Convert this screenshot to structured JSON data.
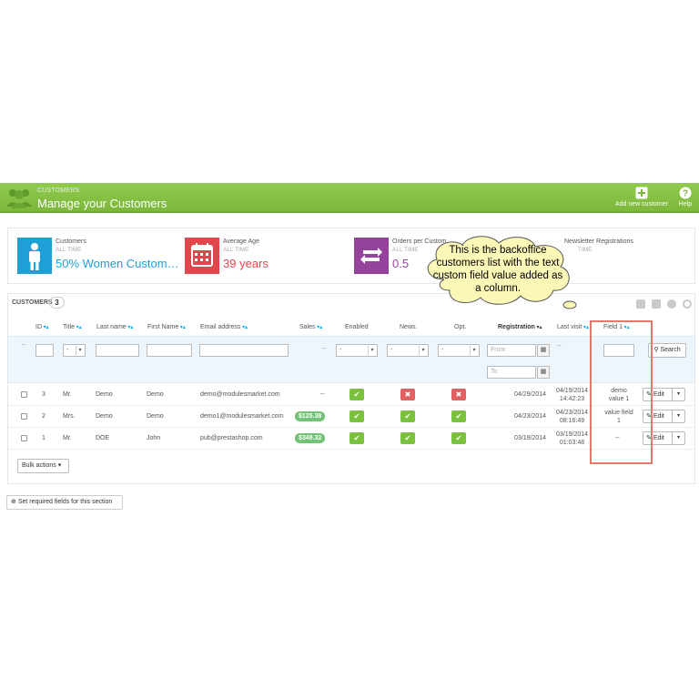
{
  "header": {
    "breadcrumb": "CUSTOMERS",
    "title": "Manage your Customers",
    "add_label": "Add new customer",
    "help_label": "Help"
  },
  "kpis": [
    {
      "label": "Customers",
      "sub": "ALL TIME",
      "value": "50% Women Custom…",
      "color": "#1e9fd6",
      "icon": "person-icon"
    },
    {
      "label": "Average Age",
      "sub": "ALL TIME",
      "value": "39 years",
      "color": "#e0474c",
      "icon": "calendar-icon"
    },
    {
      "label": "Orders per Custom",
      "sub": "ALL TIME",
      "value": "0.5",
      "color": "#93439a",
      "icon": "refresh-icon"
    },
    {
      "label": "Newsletter Registrations",
      "sub": "TIME",
      "value": "",
      "color": "#79c13e",
      "icon": "envelope-icon"
    }
  ],
  "panel": {
    "title": "CUSTOMERS",
    "count": "3"
  },
  "columns": {
    "id": "ID",
    "title": "Title",
    "last_name": "Last name",
    "first_name": "First Name",
    "email": "Email address",
    "sales": "Sales",
    "enabled": "Enabled",
    "news": "News.",
    "opt": "Opt.",
    "registration": "Registration",
    "last_visit": "Last visit",
    "field1": "Field 1"
  },
  "filters": {
    "dash1": "--",
    "sales_dash": "--",
    "lastvisit_dash": "--",
    "select_value": "-",
    "from_placeholder": "From",
    "to_placeholder": "To",
    "search_label": "Search"
  },
  "rows": [
    {
      "id": "3",
      "title": "Mr.",
      "last_name": "Demo",
      "first_name": "Demo",
      "email": "demo@modulesmarket.com",
      "sales": "--",
      "enabled": true,
      "news": false,
      "opt": false,
      "registration": "04/29/2014",
      "last_visit_date": "04/19/2014",
      "last_visit_time": "14:42:23",
      "field1_line1": "demo",
      "field1_line2": "value 1",
      "edit_label": "Edit"
    },
    {
      "id": "2",
      "title": "Mrs.",
      "last_name": "Demo",
      "first_name": "Demo",
      "email": "demo1@modulesmarket.com",
      "sales": "$125.38",
      "enabled": true,
      "news": true,
      "opt": true,
      "registration": "04/23/2014",
      "last_visit_date": "04/23/2014",
      "last_visit_time": "08:16:49",
      "field1_line1": "value field",
      "field1_line2": "1",
      "edit_label": "Edit"
    },
    {
      "id": "1",
      "title": "Mr.",
      "last_name": "DOE",
      "first_name": "John",
      "email": "pub@prestashop.com",
      "sales": "$349.32",
      "enabled": true,
      "news": true,
      "opt": true,
      "registration": "03/19/2014",
      "last_visit_date": "03/19/2014",
      "last_visit_time": "01:03:48",
      "field1_line1": "--",
      "field1_line2": "",
      "edit_label": "Edit"
    }
  ],
  "bulk_label": "Bulk actions",
  "required_fields_label": "Set required fields for this section",
  "callout": "This is the backoffice customers list with the text custom field value added as a column.",
  "colors": {
    "header_green": "#8bc34a",
    "accent_blue": "#00aff0",
    "ok_green": "#79c13e",
    "no_red": "#e06060",
    "highlight": "#e07a6a",
    "callout_fill": "#fbf7b6"
  }
}
